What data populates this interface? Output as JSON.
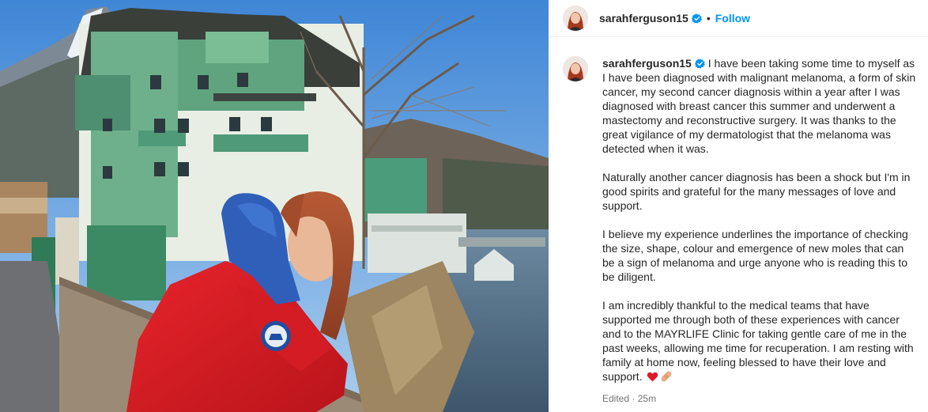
{
  "post": {
    "username": "sarahferguson15",
    "verified": true,
    "separator": "•",
    "follow_label": "Follow",
    "edited_label": "Edited",
    "meta_separator": "·",
    "time_ago": "25m",
    "paragraphs": [
      "I have been taking some time to myself as I have been diagnosed with malignant melanoma, a form of skin cancer, my second cancer diagnosis within a year after I was diagnosed with breast cancer this summer and underwent a mastectomy and reconstructive surgery. It was thanks to the great vigilance of my dermatologist that the melanoma was detected when it was.",
      "Naturally another cancer diagnosis has been a shock but I'm in good spirits and grateful for the many messages of love and support.",
      "I believe my experience underlines the importance of checking the size, shape, colour and emergence of new moles that can be a sign of melanoma and urge anyone who is reading this to be diligent.",
      "I am incredibly thankful to the medical teams that have supported me through both of these experiences with cancer and to the MAYRLIFE Clinic for taking gentle care of me in the past weeks, allowing me time for recuperation. I am resting with family at home now, feeling blessed to have their love and support."
    ],
    "trailing_emojis": [
      "red-heart-icon",
      "bandage-icon"
    ]
  },
  "colors": {
    "follow_blue": "#0095f6",
    "verified_blue": "#0095f6",
    "text": "#262626",
    "muted": "#737373",
    "divider": "#efefef"
  }
}
